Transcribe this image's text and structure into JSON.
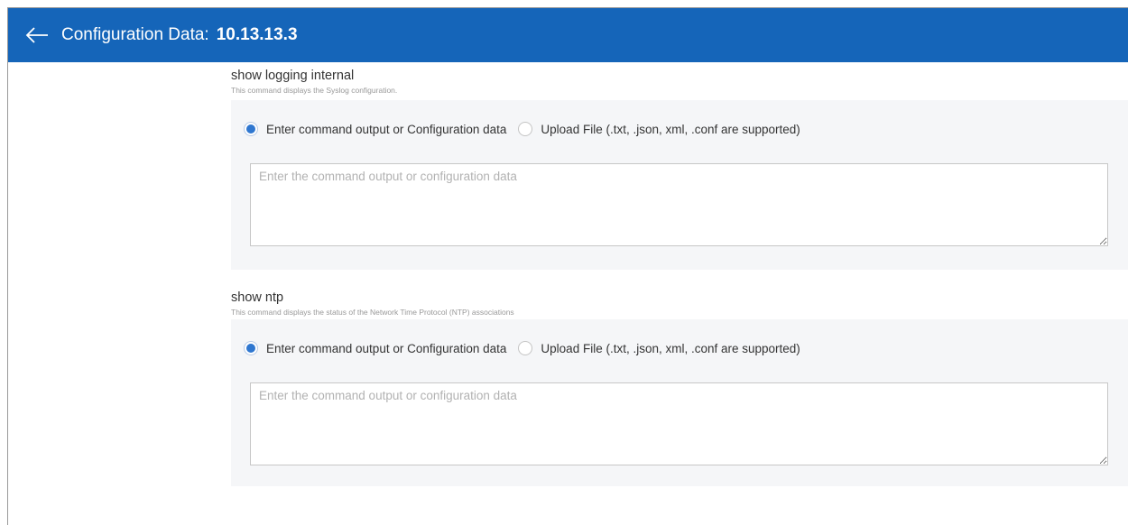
{
  "header": {
    "title": "Configuration Data:",
    "device": "10.13.13.3"
  },
  "sections": [
    {
      "title": "show logging internal",
      "description": "This command displays the Syslog configuration.",
      "option_text": "Enter command output or Configuration data",
      "option_upload": "Upload File (.txt, .json, xml, .conf are supported)",
      "selected": "text",
      "placeholder": "Enter the command output or configuration data",
      "value": ""
    },
    {
      "title": "show ntp",
      "description": "This command displays the status of the Network Time Protocol (NTP) associations",
      "option_text": "Enter command output or Configuration data",
      "option_upload": "Upload File (.txt, .json, xml, .conf are supported)",
      "selected": "text",
      "placeholder": "Enter the command output or configuration data",
      "value": ""
    }
  ],
  "icons": {
    "back": "arrow-left-icon"
  },
  "colors": {
    "header_bg": "#1565b9",
    "radio_selected": "#2f77d0",
    "panel_bg": "#f5f6f8"
  }
}
